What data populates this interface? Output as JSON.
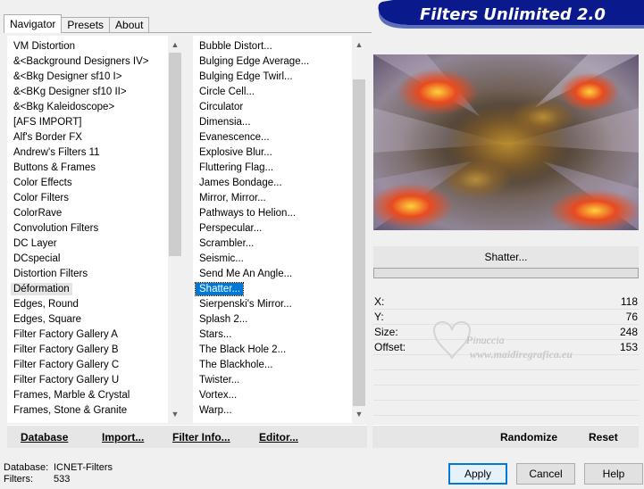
{
  "tabs": [
    "Navigator",
    "Presets",
    "About"
  ],
  "banner": {
    "title": "Filters Unlimited 2.0"
  },
  "categories": [
    "VM Distortion",
    "&<Background Designers IV>",
    "&<Bkg Designer sf10 I>",
    "&<BKg Designer sf10 II>",
    "&<Bkg Kaleidoscope>",
    "[AFS IMPORT]",
    "Alf's Border FX",
    "Andrew's Filters 11",
    "Buttons & Frames",
    "Color Effects",
    "Color Filters",
    "ColorRave",
    "Convolution Filters",
    "DC Layer",
    "DCspecial",
    "Distortion Filters",
    "Déformation",
    "Edges, Round",
    "Edges, Square",
    "Filter Factory Gallery A",
    "Filter Factory Gallery B",
    "Filter Factory Gallery C",
    "Filter Factory Gallery U",
    "Frames, Marble & Crystal",
    "Frames, Stone & Granite"
  ],
  "selected_category_index": 16,
  "filters": [
    "Bubble Distort...",
    "Bulging Edge Average...",
    "Bulging Edge Twirl...",
    "Circle Cell...",
    "Circulator",
    "Dimensia...",
    "Evanescence...",
    "Explosive Blur...",
    "Fluttering Flag...",
    "James Bondage...",
    "Mirror, Mirror...",
    "Pathways to Helion...",
    "Perspecular...",
    "Scrambler...",
    "Seismic...",
    "Send Me An Angle...",
    "Shatter...",
    "Sierpenski's Mirror...",
    "Splash 2...",
    "Stars...",
    "The Black Hole 2...",
    "The Blackhole...",
    "Twister...",
    "Vortex...",
    "Warp..."
  ],
  "selected_filter_index": 16,
  "left_buttons": {
    "database": "Database",
    "import": "Import...",
    "filter_info": "Filter Info...",
    "editor": "Editor..."
  },
  "right_buttons": {
    "randomize": "Randomize",
    "reset": "Reset"
  },
  "current_filter": "Shatter...",
  "params": [
    {
      "label": "X:",
      "value": "118"
    },
    {
      "label": "Y:",
      "value": "76"
    },
    {
      "label": "Size:",
      "value": "248"
    },
    {
      "label": "Offset:",
      "value": "153"
    }
  ],
  "watermark": {
    "line1": "Pinuccia",
    "line2": "www.maidiregrafica.eu"
  },
  "status": {
    "db_label": "Database:",
    "db_value": "ICNET-Filters",
    "filters_label": "Filters:",
    "filters_value": "533"
  },
  "dialog_buttons": {
    "apply": "Apply",
    "cancel": "Cancel",
    "help": "Help"
  },
  "colors": {
    "accent": "#0078d7",
    "banner": "#0a1a8c",
    "selection_gray": "#e5e5e5"
  }
}
